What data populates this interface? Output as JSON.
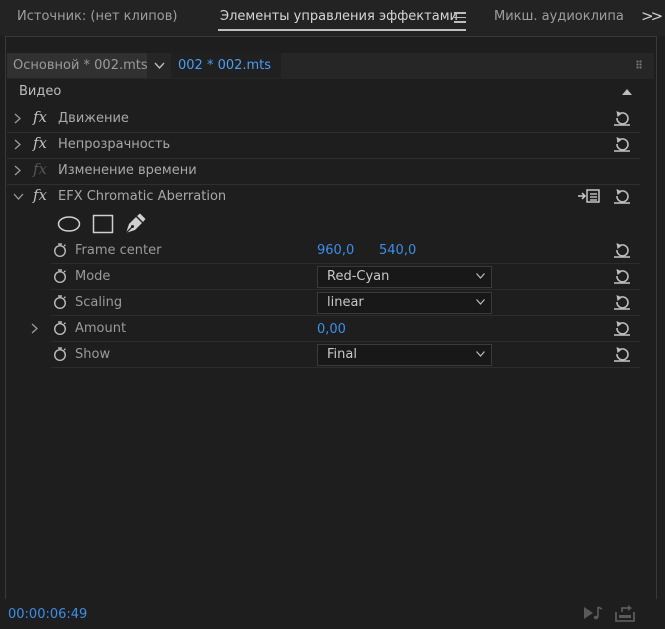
{
  "panel_tabs": [
    {
      "label": "Источник: (нет клипов)",
      "active": false
    },
    {
      "label": "Элементы управления эффектами",
      "active": true
    },
    {
      "label": "Микш. аудиоклипа",
      "active": false
    }
  ],
  "more_label": ">>",
  "clip": {
    "master_label": "Основной * 002.mts",
    "selected_label": "002 * 002.mts"
  },
  "section_title": "Видео",
  "effects": [
    {
      "name": "Движение",
      "expanded": false,
      "enabled": true
    },
    {
      "name": "Непрозрачность",
      "expanded": false,
      "enabled": true
    },
    {
      "name": "Изменение времени",
      "expanded": false,
      "enabled": false
    },
    {
      "name": "EFX Chromatic Aberration",
      "expanded": true,
      "enabled": true
    }
  ],
  "params": {
    "frame_center": {
      "label": "Frame center",
      "x": "960,0",
      "y": "540,0"
    },
    "mode": {
      "label": "Mode",
      "value": "Red-Cyan"
    },
    "scaling": {
      "label": "Scaling",
      "value": "linear"
    },
    "amount": {
      "label": "Amount",
      "value": "0,00"
    },
    "show": {
      "label": "Show",
      "value": "Final"
    }
  },
  "timecode": "00:00:06:49",
  "colors": {
    "accent": "#3d8ee9",
    "background": "#1e1e1e",
    "text": "#a8a8a8"
  }
}
